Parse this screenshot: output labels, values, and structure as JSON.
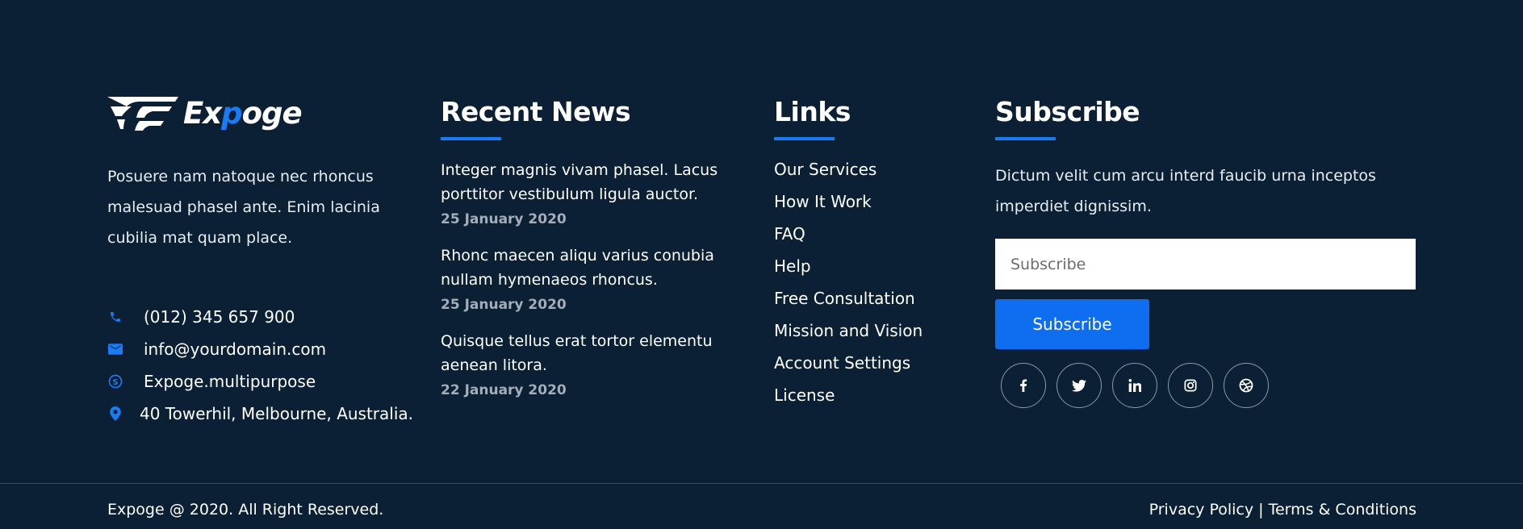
{
  "brand": {
    "name_part1": "Ex",
    "name_highlight": "p",
    "name_part2": "oge",
    "accent_color": "#1a7cf5",
    "background_color": "#0b1f35"
  },
  "about": {
    "text": "Posuere nam natoque nec rhoncus malesuad phasel ante. Enim lacinia cubilia mat quam place.",
    "contacts": [
      {
        "icon": "phone-icon",
        "text": "(012) 345 657 900"
      },
      {
        "icon": "mail-icon",
        "text": "info@yourdomain.com"
      },
      {
        "icon": "skype-icon",
        "text": "Expoge.multipurpose"
      },
      {
        "icon": "location-pin-icon",
        "text": "40 Towerhil, Melbourne, Australia."
      }
    ]
  },
  "news": {
    "title": "Recent News",
    "items": [
      {
        "title": "Integer magnis vivam phasel. Lacus porttitor vestibulum ligula auctor.",
        "date": "25 January 2020"
      },
      {
        "title": "Rhonc maecen aliqu varius conubia nullam hymenaeos rhoncus.",
        "date": "25 January 2020"
      },
      {
        "title": "Quisque tellus erat tortor elementu aenean litora.",
        "date": "22 January 2020"
      }
    ]
  },
  "links": {
    "title": "Links",
    "items": [
      "Our Services",
      "How It Work",
      "FAQ",
      "Help",
      "Free Consultation",
      "Mission and Vision",
      "Account Settings",
      "License"
    ]
  },
  "subscribe": {
    "title": "Subscribe",
    "text": "Dictum velit cum arcu interd faucib urna inceptos imperdiet dignissim.",
    "input_placeholder": "Subscribe",
    "input_value": "",
    "button_label": "Subscribe",
    "social": [
      "facebook-icon",
      "twitter-icon",
      "linkedin-icon",
      "instagram-icon",
      "dribbble-icon"
    ]
  },
  "bottom": {
    "copyright": "Expoge @ 2020. All Right Reserved.",
    "privacy": "Privacy Policy",
    "separator": " | ",
    "terms": "Terms & Conditions"
  }
}
